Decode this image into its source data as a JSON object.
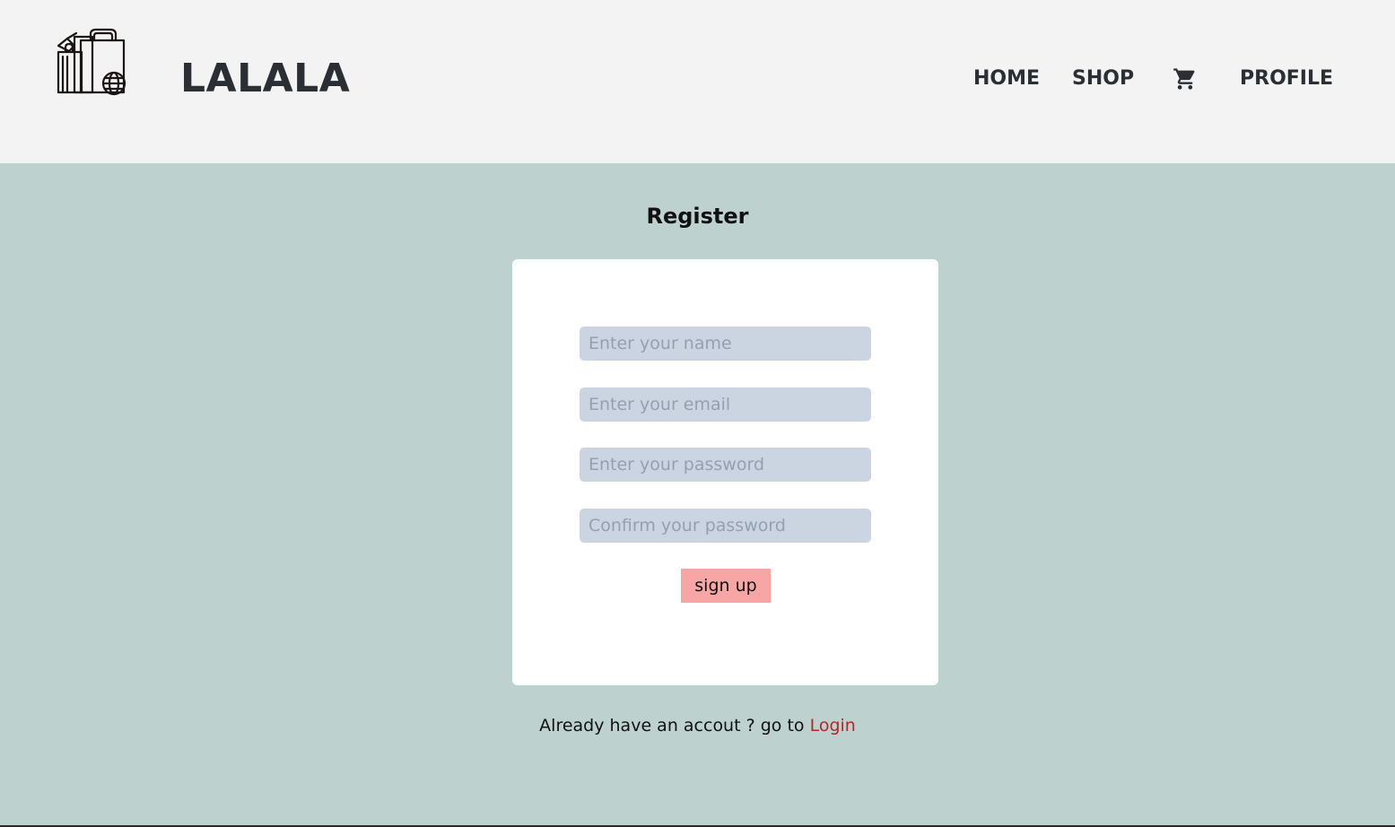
{
  "header": {
    "brand": "LALALA",
    "logo_icon": "shopping-bags-icon",
    "nav": {
      "home": "HOME",
      "shop": "SHOP",
      "cart_icon": "cart-icon",
      "profile": "PROFILE"
    }
  },
  "register": {
    "title": "Register",
    "name_placeholder": "Enter your name",
    "email_placeholder": "Enter your email",
    "password_placeholder": "Enter your password",
    "confirm_placeholder": "Confirm your password",
    "name_value": "",
    "email_value": "",
    "password_value": "",
    "confirm_value": "",
    "submit_label": "sign up"
  },
  "footer": {
    "prompt": "Already have an accout ? go to ",
    "login_label": "Login"
  },
  "colors": {
    "header_bg": "#f3f3f3",
    "page_bg": "#bdd1cf",
    "card_bg": "#ffffff",
    "input_bg": "#cbd5e1",
    "button_bg": "#f8a5a6",
    "link": "#b3262b",
    "text_dark": "#2a2f36"
  }
}
